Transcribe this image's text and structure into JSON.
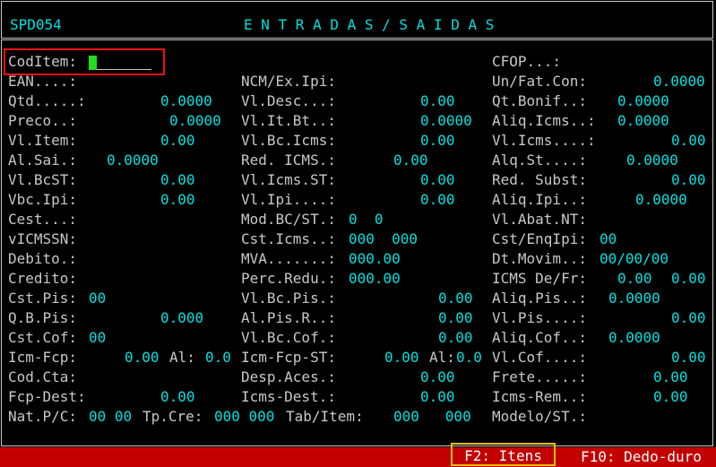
{
  "header": {
    "app_code": "SPD054",
    "title": "E N T R A D A S / S A I D A S"
  },
  "form": {
    "row1": {
      "coditem_label": "CodItem:",
      "cfop_label": "CFOP...:"
    },
    "row2": {
      "ean_label": "EAN....:",
      "ncm_label": "NCM/Ex.Ipi:",
      "unfat_label": "Un/Fat.Con:",
      "unfat_value": "0.0000"
    },
    "row3": {
      "qtd_label": "Qtd.....:",
      "qtd_value": "0.0000",
      "vldesc_label": "Vl.Desc...:",
      "vldesc_value": "0.00",
      "qtbonif_label": "Qt.Bonif..:",
      "qtbonif_value": "0.0000"
    },
    "row4": {
      "preco_label": "Preco..:",
      "preco_value": "0.0000",
      "vlitbt_label": "Vl.It.Bt..:",
      "vlitbt_value": "0.0000",
      "aliqicms_label": "Aliq.Icms..:",
      "aliqicms_value": "0.0000"
    },
    "row5": {
      "vlitem_label": "Vl.Item:",
      "vlitem_value": "0.00",
      "vlbcicms_label": "Vl.Bc.Icms:",
      "vlbcicms_value": "0.00",
      "vlicms_label": "Vl.Icms....:",
      "vlicms_value": "0.00"
    },
    "row6": {
      "alsai_label": "Al.Sai.:",
      "alsai_value": "0.0000",
      "redicms_label": "Red. ICMS.:",
      "redicms_value": "0.00",
      "alqst_label": "Alq.St....:",
      "alqst_value": "0.0000"
    },
    "row7": {
      "vlbcst_label": "Vl.BcST:",
      "vlbcst_value": "0.00",
      "vlicmsst_label": "Vl.Icms.ST:",
      "vlicmsst_value": "0.00",
      "redsubst_label": "Red. Subst:",
      "redsubst_value": "0.00"
    },
    "row8": {
      "vbcipi_label": "Vbc.Ipi:",
      "vbcipi_value": "0.00",
      "vlipi_label": "Vl.Ipi....:",
      "vlipi_value": "0.00",
      "aliqipi_label": "Aliq.Ipi..:",
      "aliqipi_value": "0.0000"
    },
    "row9": {
      "cest_label": "Cest...:",
      "modbc_label": "Mod.BC/ST.:",
      "modbc_value": "0  0",
      "vlabat_label": "Vl.Abat.NT:"
    },
    "row10": {
      "vicmssn_label": "vICMSSN:",
      "csticms_label": "Cst.Icms..:",
      "csticms_value": "000  000",
      "cstenq_label": "Cst/EnqIpi:",
      "cstenq_value": "00"
    },
    "row11": {
      "debito_label": "Debito.:",
      "mva_label": "MVA.......:",
      "mva_value": "000.00",
      "dtmovim_label": "Dt.Movim..:",
      "dtmovim_value": "00/00/00"
    },
    "row12": {
      "credito_label": "Credito:",
      "percredu_label": "Perc.Redu.:",
      "percredu_value": "000.00",
      "icmsdefr_label": "ICMS De/Fr:",
      "icmsdefr_value1": "0.00",
      "icmsdefr_value2": "0.00"
    },
    "row13": {
      "cstpis_label": "Cst.Pis:",
      "cstpis_value": "00",
      "vlbcpis_label": "Vl.Bc.Pis.:",
      "vlbcpis_value": "0.00",
      "aliqpis_label": "Aliq.Pis..:",
      "aliqpis_value": "0.0000"
    },
    "row14": {
      "qbpis_label": "Q.B.Pis:",
      "qbpis_value": "0.000",
      "alpisr_label": "Al.Pis.R..:",
      "alpisr_value": "0.00",
      "vlpis_label": "Vl.Pis....:",
      "vlpis_value": "0.00"
    },
    "row15": {
      "cstcof_label": "Cst.Cof:",
      "cstcof_value": "00",
      "vlbccof_label": "Vl.Bc.Cof.:",
      "vlbccof_value": "0.00",
      "aliqcof_label": "Aliq.Cof..:",
      "aliqcof_value": "0.0000"
    },
    "row16": {
      "icmfcp_label": "Icm-Fcp:",
      "icmfcp_value": "0.00",
      "al1_label": "Al:",
      "al1_value": "0.0",
      "icmfcpst_label": "Icm-Fcp-ST:",
      "icmfcpst_value": "0.00",
      "al2_label": "Al:",
      "al2_value": "0.0",
      "vlcof_label": "Vl.Cof....:",
      "vlcof_value": "0.00"
    },
    "row17": {
      "codcta_label": "Cod.Cta:",
      "despaces_label": "Desp.Aces.:",
      "despaces_value": "0.00",
      "frete_label": "Frete.....:",
      "frete_value": "0.00"
    },
    "row18": {
      "fcpdest_label": "Fcp-Dest:",
      "fcpdest_value": "0.00",
      "icmsdest_label": "Icms-Dest.:",
      "icmsdest_value": "0.00",
      "icmsrem_label": "Icms-Rem..:",
      "icmsrem_value": "0.00"
    },
    "row19": {
      "natpc_label": "Nat.P/C:",
      "natpc_value": "00 00",
      "tpcre_label": "Tp.Cre:",
      "tpcre_value": "000 000",
      "tabitem_label": "Tab/Item:",
      "tabitem_value": "000   000",
      "modelo_label": "Modelo/ST.:"
    }
  },
  "status_bar": {
    "f2_label": "F2: Itens",
    "f10_label": "F10: Dedo-duro"
  },
  "colors": {
    "background": "#000000",
    "label": "#c8c8c8",
    "value": "#00e0e0",
    "status_bar": "#c20000",
    "cursor": "#22dd22",
    "highlight_red": "#ee1111",
    "highlight_yellow": "#f0c000"
  }
}
